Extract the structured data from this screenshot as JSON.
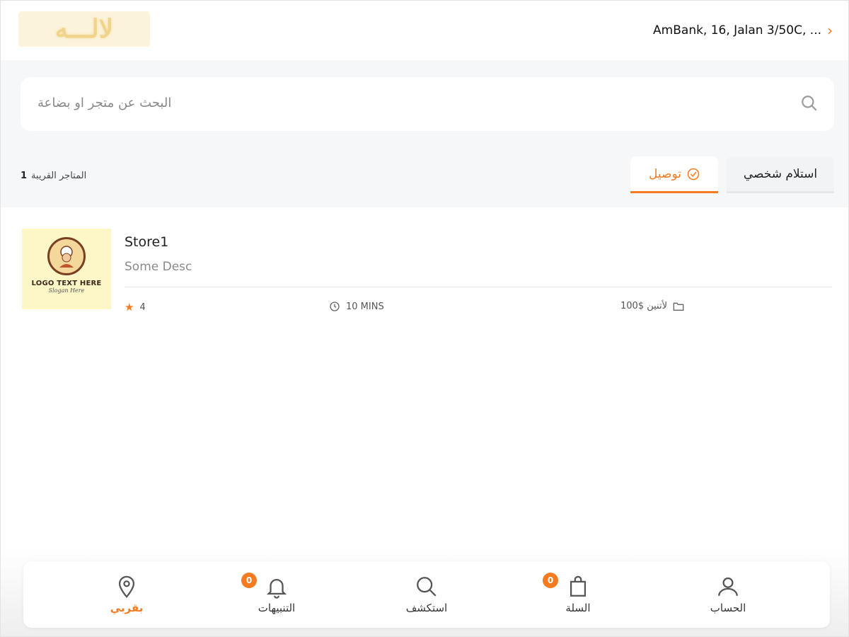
{
  "header": {
    "logo_text": "لالـــه",
    "location": "AmBank, 16, Jalan 3/50C, ..."
  },
  "search": {
    "placeholder": "البحث عن متجر او بضاعة"
  },
  "nearby": {
    "label": "المتاجر القريبة",
    "count": "1"
  },
  "tabs": {
    "pickup": "استلام شخصي",
    "delivery": "توصيل"
  },
  "store": {
    "name": "Store1",
    "desc": "Some Desc",
    "logo_text": "LOGO TEXT HERE",
    "logo_sub": "Slogan Here",
    "rating": "4",
    "time": "10 MINS",
    "min_order": "لأتنين $100"
  },
  "nav": {
    "nearby": "بقربي",
    "notifications": "التنبيهات",
    "notifications_count": "0",
    "explore": "استكشف",
    "cart": "السلة",
    "cart_count": "0",
    "account": "الحساب"
  },
  "colors": {
    "accent": "#f47b20",
    "background_gray": "#f6f7f9"
  }
}
